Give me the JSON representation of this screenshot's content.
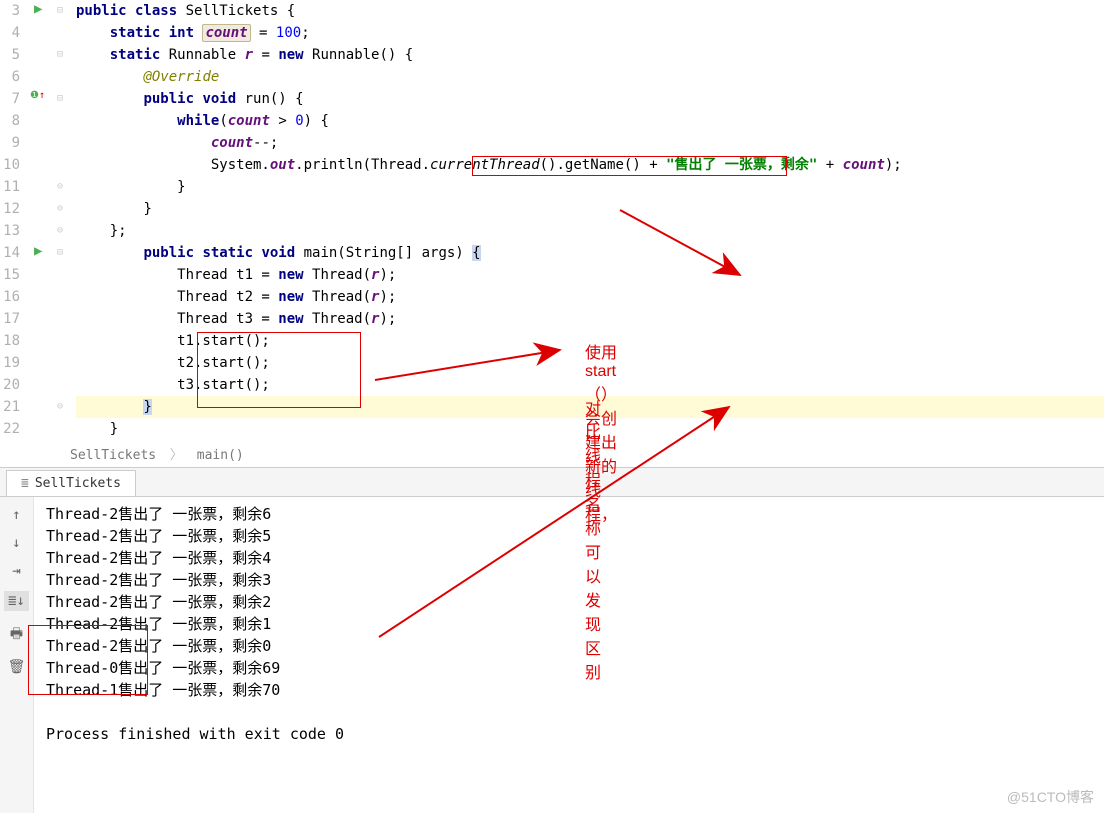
{
  "editor": {
    "line_numbers": [
      "3",
      "4",
      "5",
      "6",
      "7",
      "8",
      "9",
      "10",
      "11",
      "12",
      "13",
      "14",
      "15",
      "16",
      "17",
      "18",
      "19",
      "20",
      "21",
      "22"
    ],
    "lines": {
      "l3": {
        "pre": "",
        "k1": "public class",
        "rest": " SellTickets {"
      },
      "l4": {
        "prefix": "    ",
        "k1": "static int",
        "sp": " ",
        "id": "count",
        "rest": " = ",
        "num": "100",
        "end": ";"
      },
      "l5": {
        "prefix": "    ",
        "k1": "static",
        "sp": " ",
        "id2": "Runnable ",
        "field": "r",
        "eq": " = ",
        "k2": "new",
        "rest": " Runnable() {"
      },
      "l6": {
        "prefix": "        ",
        "annot": "@Override"
      },
      "l7": {
        "prefix": "        ",
        "k1": "public void",
        "rest": " run() {"
      },
      "l8": {
        "prefix": "            ",
        "k1": "while",
        "paren": "(",
        "field": "count",
        "rest": " > ",
        "num": "0",
        "end": ") {"
      },
      "l9": {
        "prefix": "                ",
        "field": "count",
        "rest": "--;"
      },
      "l10": {
        "prefix": "                ",
        "a": "System.",
        "b": "out",
        "c": ".println(",
        "box": "Thread.currentThread().getName()",
        "plus": " + ",
        "str": "\"售出了 一张票，剩余\"",
        "plus2": " + ",
        "field": "count",
        "end": ");"
      },
      "l11": {
        "prefix": "            ",
        "brace": "}"
      },
      "l12": {
        "prefix": "        ",
        "brace": "}"
      },
      "l13": {
        "prefix": "    ",
        "brace": "};"
      },
      "l14": {
        "prefix": "        ",
        "k1": "public static void",
        "rest": " main(String[] args) ",
        "br": "{"
      },
      "l15": {
        "prefix": "            Thread t1 = ",
        "k1": "new",
        "rest": " Thread(",
        "field": "r",
        "end": ");"
      },
      "l16": {
        "prefix": "            Thread t2 = ",
        "k1": "new",
        "rest": " Thread(",
        "field": "r",
        "end": ");"
      },
      "l17": {
        "prefix": "            Thread t3 = ",
        "k1": "new",
        "rest": " Thread(",
        "field": "r",
        "end": ");"
      },
      "l18": {
        "prefix": "            t1.start();"
      },
      "l19": {
        "prefix": "            t2.start();"
      },
      "l20": {
        "prefix": "            t3.start();"
      },
      "l21": {
        "prefix": "        ",
        "brace": "}"
      },
      "l22": {
        "prefix": "    }"
      }
    }
  },
  "breadcrumb": {
    "a": "SellTickets",
    "b": "main()"
  },
  "tab": {
    "name": "SellTickets"
  },
  "console": {
    "lines": [
      "Thread-2售出了 一张票，剩余6",
      "Thread-2售出了 一张票，剩余5",
      "Thread-2售出了 一张票，剩余4",
      "Thread-2售出了 一张票，剩余3",
      "Thread-2售出了 一张票，剩余2",
      "Thread-2售出了 一张票，剩余1",
      "Thread-2售出了 一张票，剩余0",
      "Thread-0售出了 一张票，剩余69",
      "Thread-1售出了 一张票，剩余70",
      "",
      "Process finished with exit code 0"
    ]
  },
  "annotations": {
    "t1": "使用start（）会创建出新的线程，",
    "t2": "对比线程名称可以发现区别"
  },
  "watermark": "@51CTO博客"
}
